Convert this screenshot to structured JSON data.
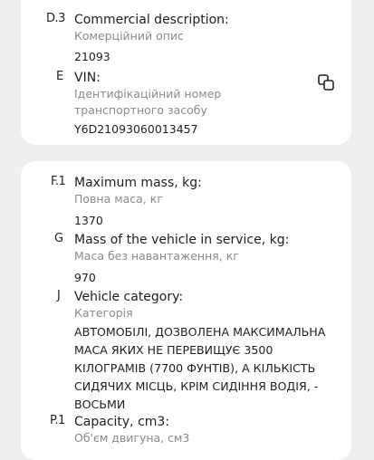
{
  "fields_top": [
    {
      "code": "D.3",
      "label": "Commercial description:",
      "sublabel": "Комерційний опис",
      "value": "21093"
    },
    {
      "code": "E",
      "label": "VIN:",
      "sublabel": "Ідентифікаційний номер транспортного засобу",
      "value": "Y6D21093060013457",
      "icon": "copy-icon"
    }
  ],
  "fields_bottom": [
    {
      "code": "F.1",
      "label": "Maximum mass, kg:",
      "sublabel": "Повна маса, кг",
      "value": "1370"
    },
    {
      "code": "G",
      "label": "Mass of the vehicle in service, kg:",
      "sublabel": "Маса без навантаження, кг",
      "value": "970"
    },
    {
      "code": "J",
      "label": "Vehicle category:",
      "sublabel": "Категорія",
      "value": "АВТОМОБІЛІ, ДОЗВОЛЕНА МАКСИМАЛЬНА МАСА ЯКИХ НЕ ПЕРЕВИЩУЄ 3500 КІЛОГРАМІВ (7700 ФУНТІВ), А КІЛЬКІСТЬ СИДЯЧИХ МІСЦЬ, КРІМ СИДІННЯ ВОДІЯ, - ВОСЬМИ"
    },
    {
      "code": "P.1",
      "label": "Capacity, cm3:",
      "sublabel": "Об'єм двигуна, см3"
    }
  ]
}
